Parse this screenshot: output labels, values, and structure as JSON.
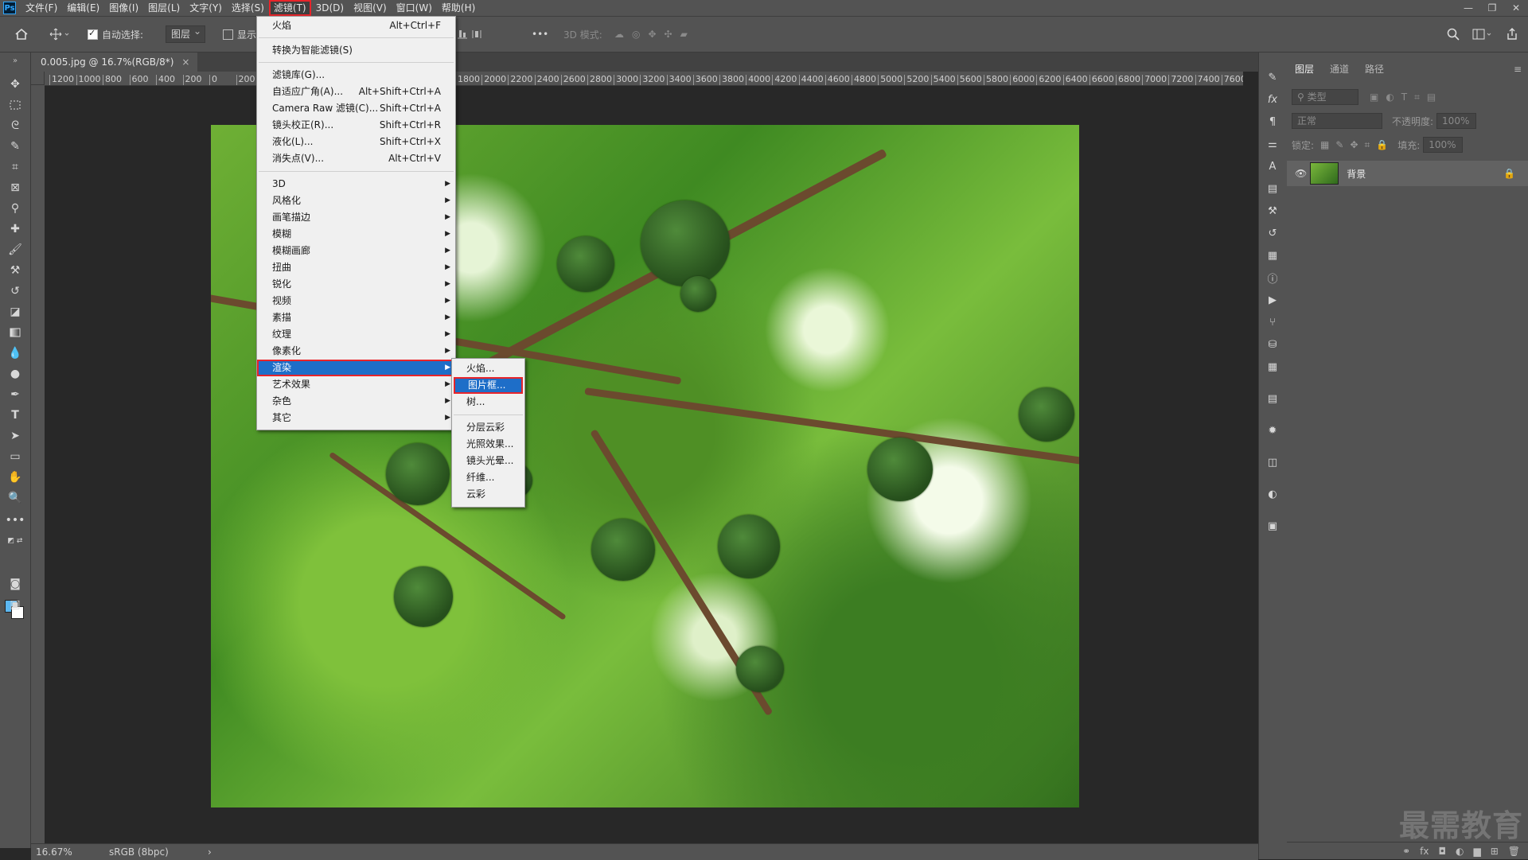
{
  "app": {
    "logo": "Ps"
  },
  "menubar": {
    "items": [
      "文件(F)",
      "编辑(E)",
      "图像(I)",
      "图层(L)",
      "文字(Y)",
      "选择(S)",
      "滤镜(T)",
      "3D(D)",
      "视图(V)",
      "窗口(W)",
      "帮助(H)"
    ],
    "active_index": 6
  },
  "window_controls": {
    "minimize": "—",
    "restore": "❐",
    "close": "✕"
  },
  "options_bar": {
    "auto_select_label": "自动选择:",
    "auto_select_checked": true,
    "auto_select_target": "图层",
    "show_transform_label": "显示",
    "mode_3d_label": "3D 模式:",
    "more_label": "•••"
  },
  "document": {
    "tab_title": "0.005.jpg @ 16.7%(RGB/8*)",
    "tab_close": "×"
  },
  "ruler": {
    "left_ticks": [
      "1200",
      "1000",
      "800",
      "600",
      "400",
      "200",
      "0",
      "200"
    ],
    "right_ticks": [
      "1800",
      "2000",
      "2200",
      "2400",
      "2600",
      "2800",
      "3000",
      "3200",
      "3400",
      "3600",
      "3800",
      "4000",
      "4200",
      "4400",
      "4600",
      "4800",
      "5000",
      "5200",
      "5400",
      "5600",
      "5800",
      "6000",
      "6200",
      "6400",
      "6600",
      "6800",
      "7000",
      "7200",
      "7400",
      "7600"
    ]
  },
  "status": {
    "zoom": "16.67%",
    "profile": "sRGB (8bpc)",
    "arrow": "›"
  },
  "filter_menu": {
    "items": [
      {
        "label": "火焰",
        "shortcut": "Alt+Ctrl+F"
      },
      {
        "label": "转换为智能滤镜(S)",
        "shortcut": ""
      },
      {
        "label": "滤镜库(G)...",
        "shortcut": ""
      },
      {
        "label": "自适应广角(A)...",
        "shortcut": "Alt+Shift+Ctrl+A"
      },
      {
        "label": "Camera Raw 滤镜(C)...",
        "shortcut": "Shift+Ctrl+A"
      },
      {
        "label": "镜头校正(R)...",
        "shortcut": "Shift+Ctrl+R"
      },
      {
        "label": "液化(L)...",
        "shortcut": "Shift+Ctrl+X"
      },
      {
        "label": "消失点(V)...",
        "shortcut": "Alt+Ctrl+V"
      }
    ],
    "submenus": [
      "3D",
      "风格化",
      "画笔描边",
      "模糊",
      "模糊画廊",
      "扭曲",
      "锐化",
      "视频",
      "素描",
      "纹理",
      "像素化",
      "渲染",
      "艺术效果",
      "杂色",
      "其它"
    ],
    "highlighted_submenu": "渲染"
  },
  "render_submenu": {
    "items": [
      "火焰...",
      "图片框...",
      "树...",
      "分层云彩",
      "光照效果...",
      "镜头光晕...",
      "纤维...",
      "云彩"
    ],
    "highlighted": "图片框..."
  },
  "layers_panel": {
    "tabs": [
      "图层",
      "通道",
      "路径"
    ],
    "selected_tab": "图层",
    "filter_placeholder": "类型",
    "blend_mode": "正常",
    "opacity_label": "不透明度:",
    "opacity_value": "100%",
    "lock_label": "锁定:",
    "fill_label": "填充:",
    "fill_value": "100%",
    "layers": [
      {
        "name": "背景",
        "visible": true,
        "locked": true
      }
    ],
    "bottom_icons": [
      "link-icon",
      "fx-icon",
      "mask-icon",
      "adjustment-icon",
      "group-icon",
      "new-layer-icon",
      "trash-icon"
    ],
    "bottom_labels": {
      "link": "⚭",
      "fx": "fx",
      "mask": "◘",
      "adjust": "◐",
      "group": "▆",
      "new": "⊞",
      "trash": "🗑"
    }
  },
  "watermark": "最需教育",
  "colors": {
    "accent_blue": "#1e6ec8",
    "highlight_red": "#e8242a",
    "fg_swatch": "#5cb8f2",
    "bg_swatch": "#ffffff"
  }
}
